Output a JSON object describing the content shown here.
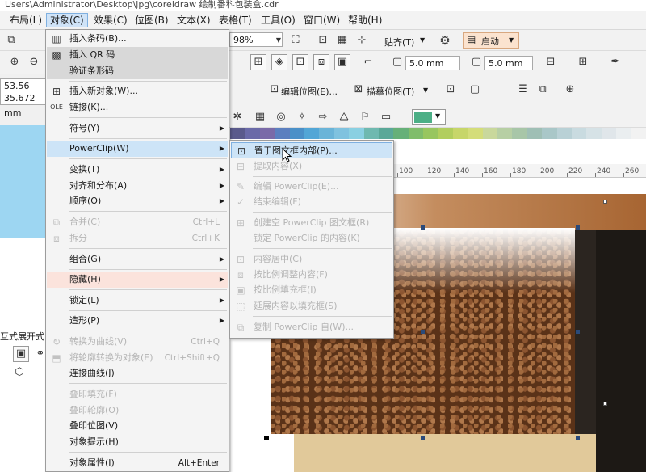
{
  "title_bar": {
    "text": "Users\\Administrator\\Desktop\\jpg\\coreldraw 绘制番科包装盒.cdr"
  },
  "menu_bar": {
    "items": [
      {
        "label": "布局(L)"
      },
      {
        "label": "对象(C)"
      },
      {
        "label": "效果(C)"
      },
      {
        "label": "位图(B)"
      },
      {
        "label": "文本(X)"
      },
      {
        "label": "表格(T)"
      },
      {
        "label": "工具(O)"
      },
      {
        "label": "窗口(W)"
      },
      {
        "label": "帮助(H)"
      }
    ]
  },
  "toolbar1": {
    "zoom_value": "98%",
    "snap_label": "贴齐(T)",
    "start_label": "启动"
  },
  "toolbar2": {
    "width_value": "5.0 mm",
    "height_value": "5.0 mm"
  },
  "toolbar3": {
    "edit_bitmap_label": "编辑位图(E)...",
    "trace_bitmap_label": "描摹位图(T)"
  },
  "coords": {
    "x_value": "53.56 mm",
    "y_value": "35.672 mm"
  },
  "left_panel": {
    "label": "互式展开式"
  },
  "colors": {
    "accent_swatch": "#4caf86",
    "left_panel": "#9dd6f2",
    "menu_highlight": "#d8d8d8"
  },
  "object_menu": {
    "items": [
      {
        "label": "插入条码(B)...",
        "icon": "barcode-icon"
      },
      {
        "label": "插入 QR 码",
        "icon": "qr-code-icon"
      },
      {
        "label": "验证条形码",
        "icon": ""
      },
      {
        "label": "插入新对象(W)...",
        "icon": "insert-object-icon"
      },
      {
        "label": "链接(K)...",
        "icon": "ole-icon"
      },
      {
        "label": "符号(Y)",
        "icon": ""
      },
      {
        "label": "PowerClip(W)",
        "icon": ""
      },
      {
        "label": "变换(T)",
        "icon": ""
      },
      {
        "label": "对齐和分布(A)",
        "icon": ""
      },
      {
        "label": "顺序(O)",
        "icon": ""
      },
      {
        "label": "合并(C)",
        "shortcut": "Ctrl+L",
        "icon": "combine-icon"
      },
      {
        "label": "拆分",
        "shortcut": "Ctrl+K",
        "icon": "break-apart-icon"
      },
      {
        "label": "组合(G)",
        "icon": ""
      },
      {
        "label": "隐藏(H)",
        "icon": ""
      },
      {
        "label": "锁定(L)",
        "icon": ""
      },
      {
        "label": "造形(P)",
        "icon": ""
      },
      {
        "label": "转换为曲线(V)",
        "shortcut": "Ctrl+Q",
        "icon": "convert-curves-icon"
      },
      {
        "label": "将轮廓转换为对象(E)",
        "shortcut": "Ctrl+Shift+Q",
        "icon": "outline-object-icon"
      },
      {
        "label": "连接曲线(J)",
        "icon": ""
      },
      {
        "label": "叠印填充(F)",
        "icon": ""
      },
      {
        "label": "叠印轮廓(O)",
        "icon": ""
      },
      {
        "label": "叠印位图(V)",
        "icon": ""
      },
      {
        "label": "对象提示(H)",
        "icon": ""
      },
      {
        "label": "对象属性(I)",
        "shortcut": "Alt+Enter",
        "icon": ""
      }
    ]
  },
  "powerclip_menu": {
    "items": [
      {
        "label": "置于图文框内部(P)...",
        "icon": "place-inside-frame-icon"
      },
      {
        "label": "提取内容(X)",
        "icon": "extract-content-icon"
      },
      {
        "label": "编辑 PowerClip(E)...",
        "icon": "edit-powerclip-icon"
      },
      {
        "label": "结束编辑(F)",
        "icon": "finish-edit-icon"
      },
      {
        "label": "创建空 PowerClip 图文框(R)",
        "icon": "empty-frame-icon"
      },
      {
        "label": "锁定 PowerClip 的内容(K)",
        "icon": ""
      },
      {
        "label": "内容居中(C)",
        "icon": "center-content-icon"
      },
      {
        "label": "按比例调整内容(F)",
        "icon": "fit-content-icon"
      },
      {
        "label": "按比例填充框(I)",
        "icon": "fill-frame-icon"
      },
      {
        "label": "延展内容以填充框(S)",
        "icon": "stretch-content-icon"
      },
      {
        "label": "复制 PowerClip 自(W)...",
        "icon": "copy-powerclip-icon"
      }
    ]
  },
  "ruler": {
    "ticks": [
      "100",
      "120",
      "140",
      "160",
      "180",
      "200",
      "220",
      "240",
      "260"
    ]
  }
}
